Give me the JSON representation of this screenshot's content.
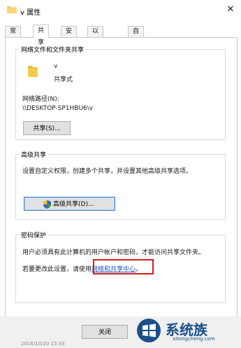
{
  "window": {
    "title": "v 属性",
    "close_glyph": "✕"
  },
  "tabs": [
    {
      "label": "常规",
      "active": false
    },
    {
      "label": "共享",
      "active": true
    },
    {
      "label": "安全",
      "active": false
    },
    {
      "label": "以前的版本",
      "active": false
    },
    {
      "label": "自定义",
      "active": false
    }
  ],
  "network_sharing": {
    "title": "网络文件和文件夹共享",
    "folder_name": "v",
    "status": "共享式",
    "path_label": "网络路径(N):",
    "path_value": "\\\\DESKTOP-SP1HBU6\\v",
    "share_button": "共享(S)..."
  },
  "advanced_sharing": {
    "title": "高级共享",
    "description": "设置自定义权限，创建多个共享，并设置其他高级共享选项。",
    "button": "高级共享(D)..."
  },
  "password_protection": {
    "title": "密码保护",
    "description": "用户必须具有此计算机的用户帐户和密码，才能访问共享文件夹。",
    "change_prefix": "若要更改此设置，请使用",
    "link_text": "网络和共享中心",
    "change_suffix": "。"
  },
  "footer": {
    "close_button": "关闭",
    "partial_text": "2016/10/20 15:33"
  },
  "watermark": {
    "brand": "系统族",
    "url": "xitongcheng.com"
  },
  "colors": {
    "folder": "#f2c94c",
    "link": "#1a54c4",
    "highlight": "#d61c1c",
    "watermark": "#1b4f8a"
  }
}
